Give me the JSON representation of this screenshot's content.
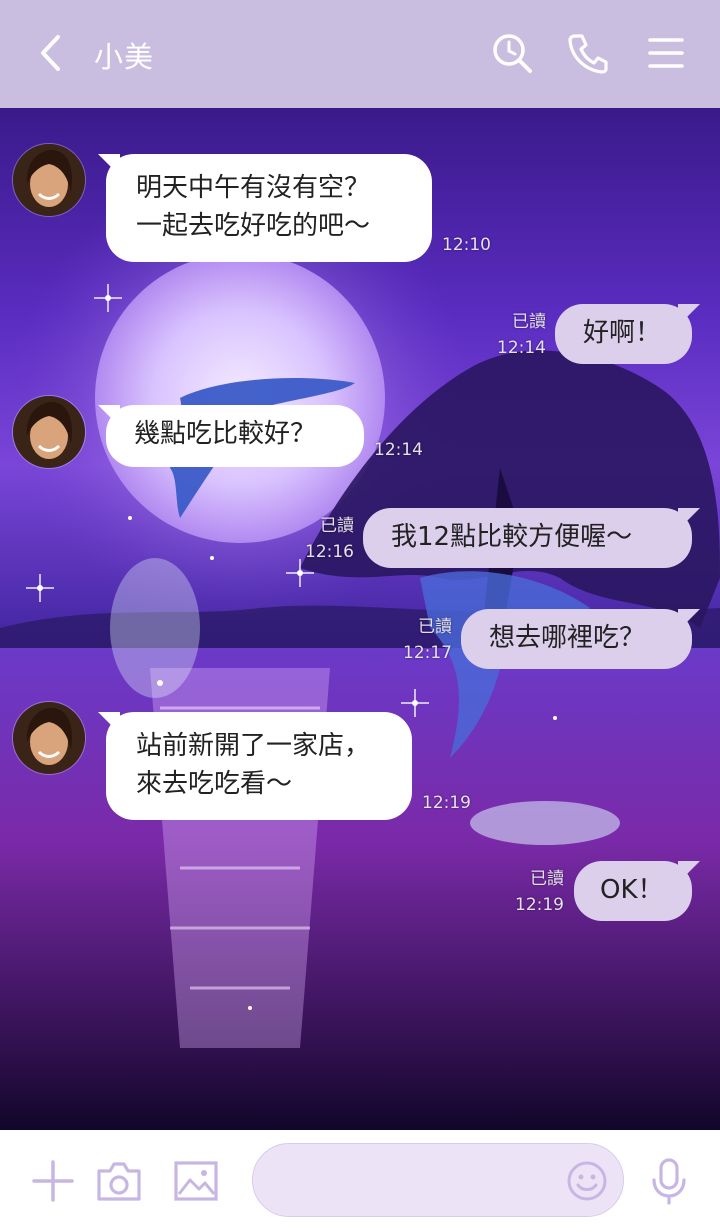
{
  "header": {
    "title": "小美",
    "icons": [
      "back-chevron-icon",
      "search-icon",
      "phone-icon",
      "menu-icon"
    ]
  },
  "colors": {
    "header_bg": "#c9bde0",
    "incoming_bubble": "#ffffff",
    "outgoing_bubble": "#dccfec",
    "accent": "#b8a6d9"
  },
  "messages": [
    {
      "id": "m1",
      "direction": "incoming",
      "text": "明天中午有沒有空？\n一起去吃好吃的吧～",
      "time": "12:10"
    },
    {
      "id": "m2",
      "direction": "outgoing",
      "text": "好啊！",
      "read": "已讀",
      "time": "12:14"
    },
    {
      "id": "m3",
      "direction": "incoming",
      "text": "幾點吃比較好？",
      "time": "12:14"
    },
    {
      "id": "m4",
      "direction": "outgoing",
      "text": "我12點比較方便喔～",
      "read": "已讀",
      "time": "12:16"
    },
    {
      "id": "m5",
      "direction": "outgoing",
      "text": "想去哪裡吃？",
      "read": "已讀",
      "time": "12:17"
    },
    {
      "id": "m6",
      "direction": "incoming",
      "text": "站前新開了一家店，\n來去吃吃看～",
      "time": "12:19"
    },
    {
      "id": "m7",
      "direction": "outgoing",
      "text": "OK！",
      "read": "已讀",
      "time": "12:19"
    }
  ],
  "footer": {
    "input_placeholder": "",
    "icons": [
      "plus-icon",
      "camera-icon",
      "image-icon",
      "emoji-icon",
      "microphone-icon"
    ]
  }
}
